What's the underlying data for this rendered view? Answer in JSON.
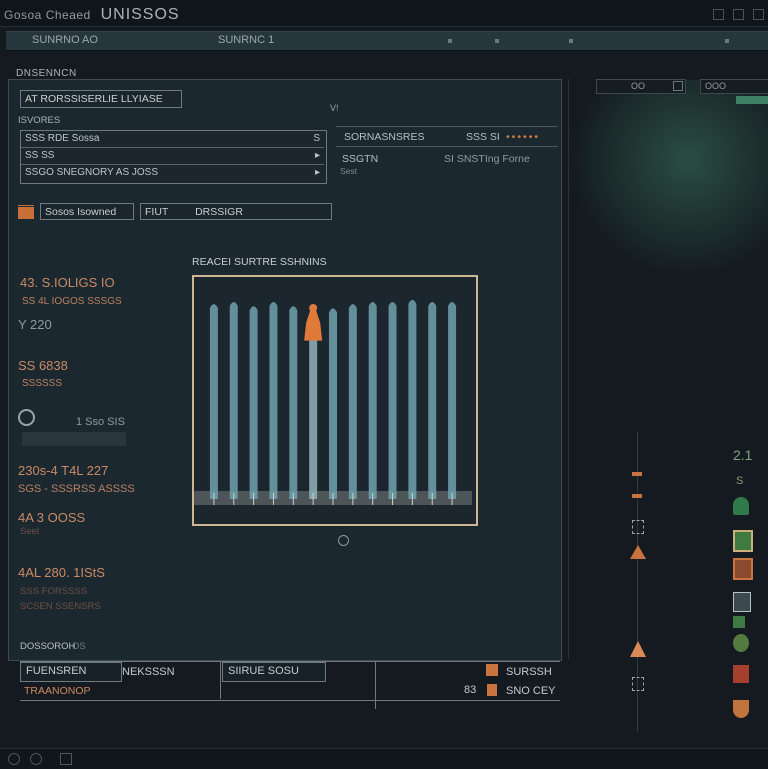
{
  "window": {
    "title_prefix": "Gosoa Cheaed",
    "title_main": "UNISSOS"
  },
  "menubar": {
    "left_label": "SUNRNO",
    "left_mark": "AO",
    "center_label": "SUNRNC 1"
  },
  "right_top": {
    "search_value": "OO",
    "search2_value": "OOO"
  },
  "panel": {
    "header": "DNSENNCN",
    "name_field": "AT RORSSISERLIE LLYIASE",
    "subheader": "ISVORES",
    "list_rows": [
      {
        "label": "SSS RDE Sossa",
        "arrow": "S"
      },
      {
        "label": "SS SS",
        "arrow": "▸"
      },
      {
        "label": "SSGO SNEGNORY AS JOSS",
        "arrow": "▸"
      }
    ],
    "right_label1": "SORNASNSRES",
    "right_value1": "SSS SI",
    "right_dots": "••••••",
    "right_label2": "SSGTN",
    "right_value2": "SI SNSTIng Forne",
    "right_small": "Sest",
    "center_mark": "V!"
  },
  "toolbar": {
    "button1": "Sosos Isowned",
    "button2": "FIUT",
    "button3": "DRSSIGR"
  },
  "stats": [
    {
      "value": "43. S.IOLIGS IO",
      "sub": "SS 4L IOGOS SSSGS"
    },
    {
      "value": "Y 220",
      "sub": ""
    },
    {
      "value": "SS 6838",
      "sub": "SSSSSS"
    },
    {
      "value": "1 Sso SIS",
      "sub": ""
    },
    {
      "value": "230s-4 T4L 227",
      "sub": "SGS - SSSRSS ASSSS"
    },
    {
      "value": "4A 3 OOSS",
      "sub": "Seel"
    },
    {
      "value": "4AL 280. 1IStS",
      "sub": "SSS FORSSSS"
    }
  ],
  "stats_dim": "SCSEN SSENSRS",
  "panel_bottom_label": "DOSSOROH",
  "panel_bottom_mark": "OS",
  "chart_data": {
    "type": "bar",
    "title": "REACEI SURTRE SSHNINS",
    "series": [
      {
        "values": [
          0.92,
          0.93,
          0.91,
          0.93,
          0.91,
          0.88,
          0.9,
          0.92,
          0.93,
          0.93,
          0.94,
          0.93,
          0.93
        ]
      }
    ],
    "highlight": {
      "index": 5,
      "value": 0.93,
      "color": "#e07a3a"
    },
    "bar_color": "#6fa2ab",
    "ylim": [
      0,
      1
    ],
    "grid": false
  },
  "chart_footer_icon": "circle-icon",
  "footer": {
    "cell1_top": "FUENSREN",
    "cell1_bottom": "TRAANONOP",
    "cell2": "NEKSSSN",
    "cell3": "SIIRUE SOSU",
    "cell4_top": "SURSSH",
    "cell4_bottom": "SNO CEY",
    "cell4_num": "83"
  },
  "right_side": {
    "number": "2.1",
    "number2": "S"
  },
  "icons": [
    "pawn-icon",
    "figure-icon",
    "cone-icon",
    "cone-icon",
    "figure-icon",
    "plant-icon",
    "photo-icon",
    "book-icon",
    "photo-icon",
    "plant-icon",
    "globe-icon",
    "flag-icon",
    "pot-icon"
  ]
}
